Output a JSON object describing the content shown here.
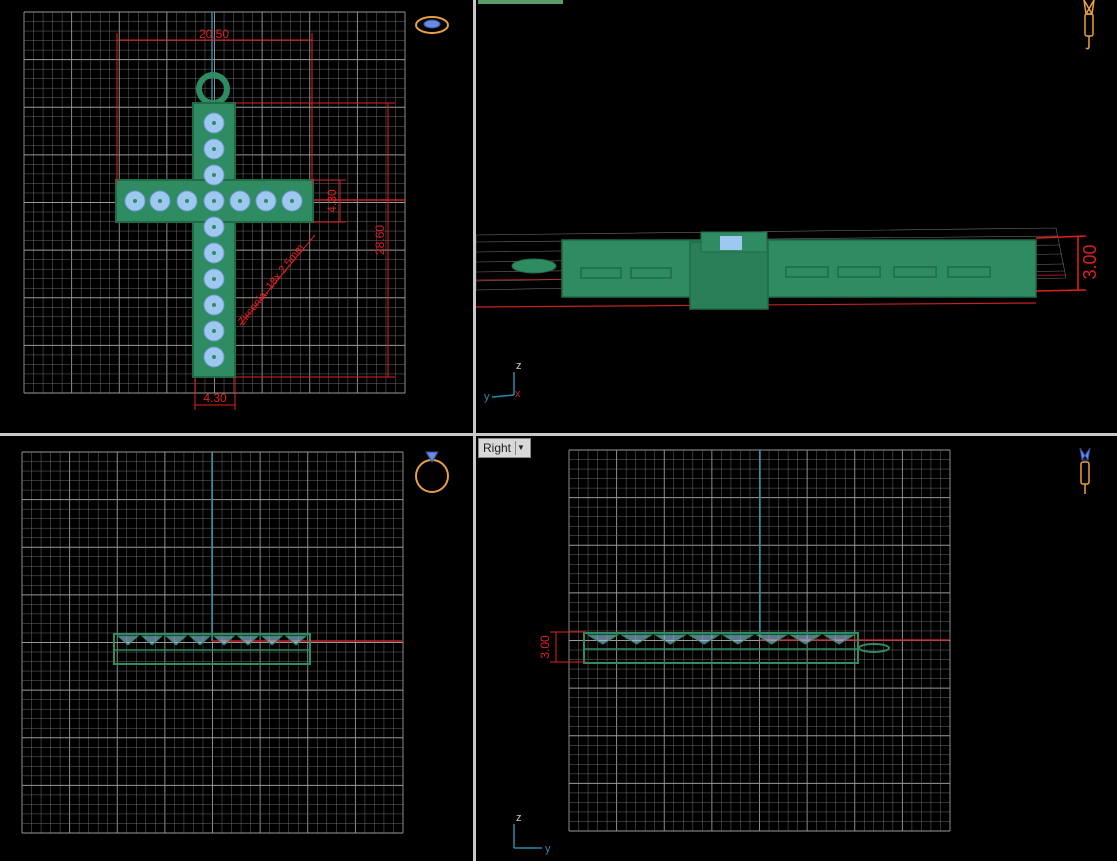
{
  "viewports": {
    "top": {
      "dim_width": "20.50",
      "dim_arm_height": "4.30",
      "dim_height": "28.60",
      "dim_stem_width": "4.30",
      "stone_note": "Zirconia: 18x 2.5mm",
      "icon": "ring-top-icon"
    },
    "perspective": {
      "dim_thickness": "3.00",
      "axis_z": "z",
      "axis_y": "y",
      "axis_x": "x",
      "icon": "earring-icon"
    },
    "front": {
      "icon": "ring-front-icon"
    },
    "right": {
      "label": "Right",
      "dim_thickness": "3.00",
      "axis_z": "z",
      "axis_y": "y",
      "icon": "earring-icon"
    }
  },
  "colors": {
    "grid": "#6a6a6a",
    "grid_major": "#9a9a9a",
    "body": "#2e8b62",
    "body_dark": "#1f6b48",
    "stone": "#9fc8f0",
    "dimension": "#e02020",
    "axis_blue": "#2a8aa8",
    "axis_red": "#c82020",
    "icon_gold": "#e8a040"
  }
}
